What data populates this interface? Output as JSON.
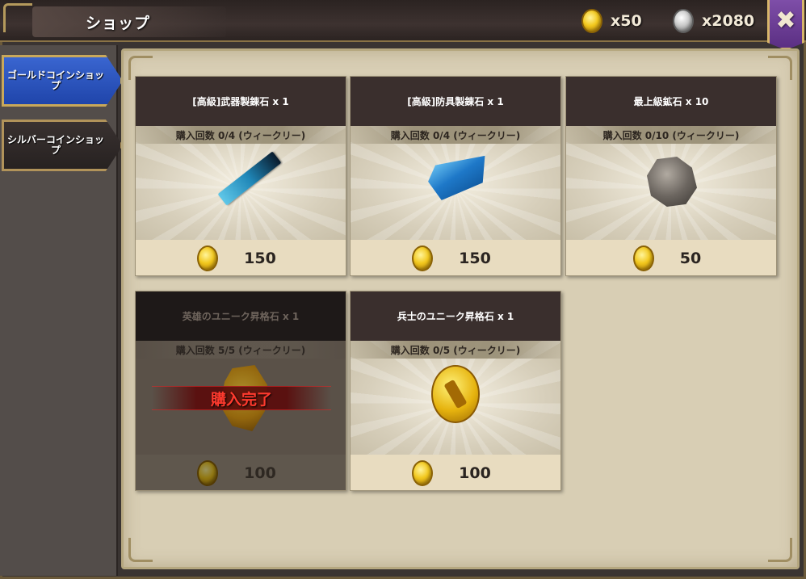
{
  "header": {
    "title": "ショップ",
    "gold_amount": "x50",
    "silver_amount": "x2080",
    "close_glyph": "✖"
  },
  "sidebar": {
    "tabs": [
      {
        "label": "ゴールドコインショップ",
        "active": true
      },
      {
        "label": "シルバーコインショップ",
        "active": false
      }
    ]
  },
  "items": [
    {
      "name": "[高級]武器製錬石 x 1",
      "limit": "購入回数 0/4 (ウィークリー)",
      "price": "150",
      "icon": "weapon-refine-stone-icon",
      "sold_out": false
    },
    {
      "name": "[高級]防具製錬石 x 1",
      "limit": "購入回数 0/4 (ウィークリー)",
      "price": "150",
      "icon": "armor-refine-ingot-icon",
      "sold_out": false
    },
    {
      "name": "最上級鉱石 x 10",
      "limit": "購入回数 0/10 (ウィークリー)",
      "price": "50",
      "icon": "ore-icon",
      "sold_out": false
    },
    {
      "name": "英雄のユニーク昇格石 x 1",
      "limit": "購入回数 5/5 (ウィークリー)",
      "price": "100",
      "icon": "hero-promotion-stone-icon",
      "sold_out": true,
      "sold_out_label": "購入完了"
    },
    {
      "name": "兵士のユニーク昇格石 x 1",
      "limit": "購入回数 0/5 (ウィークリー)",
      "price": "100",
      "icon": "soldier-promotion-stone-icon",
      "sold_out": false
    }
  ],
  "colors": {
    "active_tab": "#2a54c0",
    "sold_out_text": "#ff3a2e",
    "card_header": "#3a2f2d",
    "panel_bg": "#d8ceb4"
  }
}
